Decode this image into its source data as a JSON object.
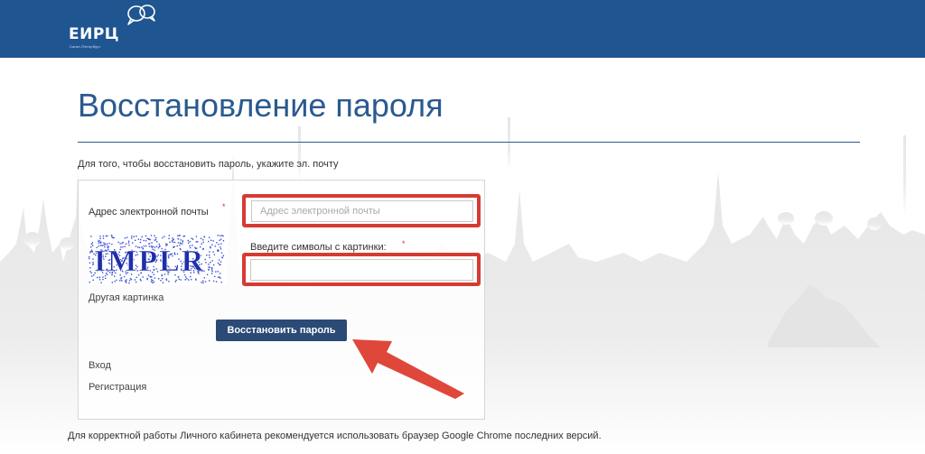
{
  "header": {
    "logo_text": "ЕИРЦ",
    "logo_subtitle": "Санкт-Петербург",
    "brand_color": "#1f5591"
  },
  "main": {
    "title": "Восстановление пароля",
    "intro": "Для того, чтобы восстановить пароль, укажите эл. почту"
  },
  "form": {
    "email_label": "Адрес электронной почты",
    "email_required_mark": "*",
    "email_value": "",
    "email_placeholder": "Адрес электронной почты",
    "captcha_label": "Введите символы с картинки:",
    "captcha_required_mark": "*",
    "captcha_value": "",
    "captcha_text": "IMPLR",
    "other_image_link": "Другая картинка",
    "submit_label": "Восстановить пароль",
    "highlight_color": "#d63b33",
    "arrow_color": "#e0473b"
  },
  "links": {
    "login": "Вход",
    "register": "Регистрация"
  },
  "footer": {
    "note": "Для корректной работы Личного кабинета рекомендуется использовать браузер Google Chrome последних версий."
  },
  "icons": {
    "logo": "speech-bubbles-icon",
    "arrow": "annotation-arrow-icon"
  }
}
